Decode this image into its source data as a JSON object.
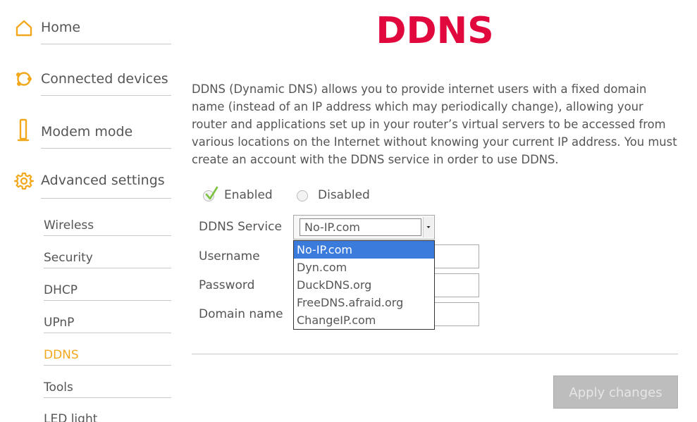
{
  "sidebar": {
    "main_items": [
      {
        "label": "Home",
        "icon": "home-icon"
      },
      {
        "label": "Connected devices",
        "icon": "devices-icon"
      },
      {
        "label": "Modem mode",
        "icon": "modem-icon"
      },
      {
        "label": "Advanced settings",
        "icon": "gear-icon"
      }
    ],
    "sub_items": [
      {
        "label": "Wireless"
      },
      {
        "label": "Security"
      },
      {
        "label": "DHCP"
      },
      {
        "label": "UPnP"
      },
      {
        "label": "DDNS",
        "active": true
      },
      {
        "label": "Tools"
      },
      {
        "label": "LED light"
      }
    ]
  },
  "main": {
    "title": "DDNS",
    "description": "DDNS (Dynamic DNS) allows you to provide internet users with a fixed domain name (instead of an IP address which may periodically change), allowing your router and applications set up in your router’s virtual servers to be accessed from various locations on the Internet without knowing your current IP address. You must create an account with the DDNS service in order to use DDNS.",
    "status": {
      "enabled_label": "Enabled",
      "disabled_label": "Disabled",
      "selected": "Enabled"
    },
    "form": {
      "service_label": "DDNS Service",
      "service_value": "No-IP.com",
      "service_options": [
        "No-IP.com",
        "Dyn.com",
        "DuckDNS.org",
        "FreeDNS.afraid.org",
        "ChangeIP.com"
      ],
      "username_label": "Username",
      "username_value": "",
      "password_label": "Password",
      "password_value": "",
      "domain_label": "Domain name",
      "domain_value": ""
    },
    "apply_label": "Apply changes"
  },
  "colors": {
    "brand": "#e0083d",
    "accent": "#f2a81d",
    "checkmark": "#7cc142",
    "selected_option": "#3a7bdc",
    "button_disabled": "#bdbdbd"
  }
}
